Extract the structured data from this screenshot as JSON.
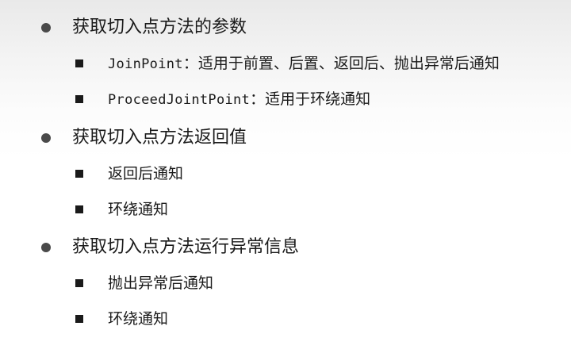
{
  "bullets": [
    {
      "text": "获取切入点方法的参数",
      "children": [
        {
          "code": "JoinPoint",
          "text": "：适用于前置、后置、返回后、抛出异常后通知"
        },
        {
          "code": "ProceedJointPoint",
          "text": "：适用于环绕通知"
        }
      ]
    },
    {
      "text": "获取切入点方法返回值",
      "children": [
        {
          "text": "返回后通知"
        },
        {
          "text": "环绕通知"
        }
      ]
    },
    {
      "text": "获取切入点方法运行异常信息",
      "children": [
        {
          "text": "抛出异常后通知"
        },
        {
          "text": "环绕通知"
        }
      ]
    }
  ]
}
